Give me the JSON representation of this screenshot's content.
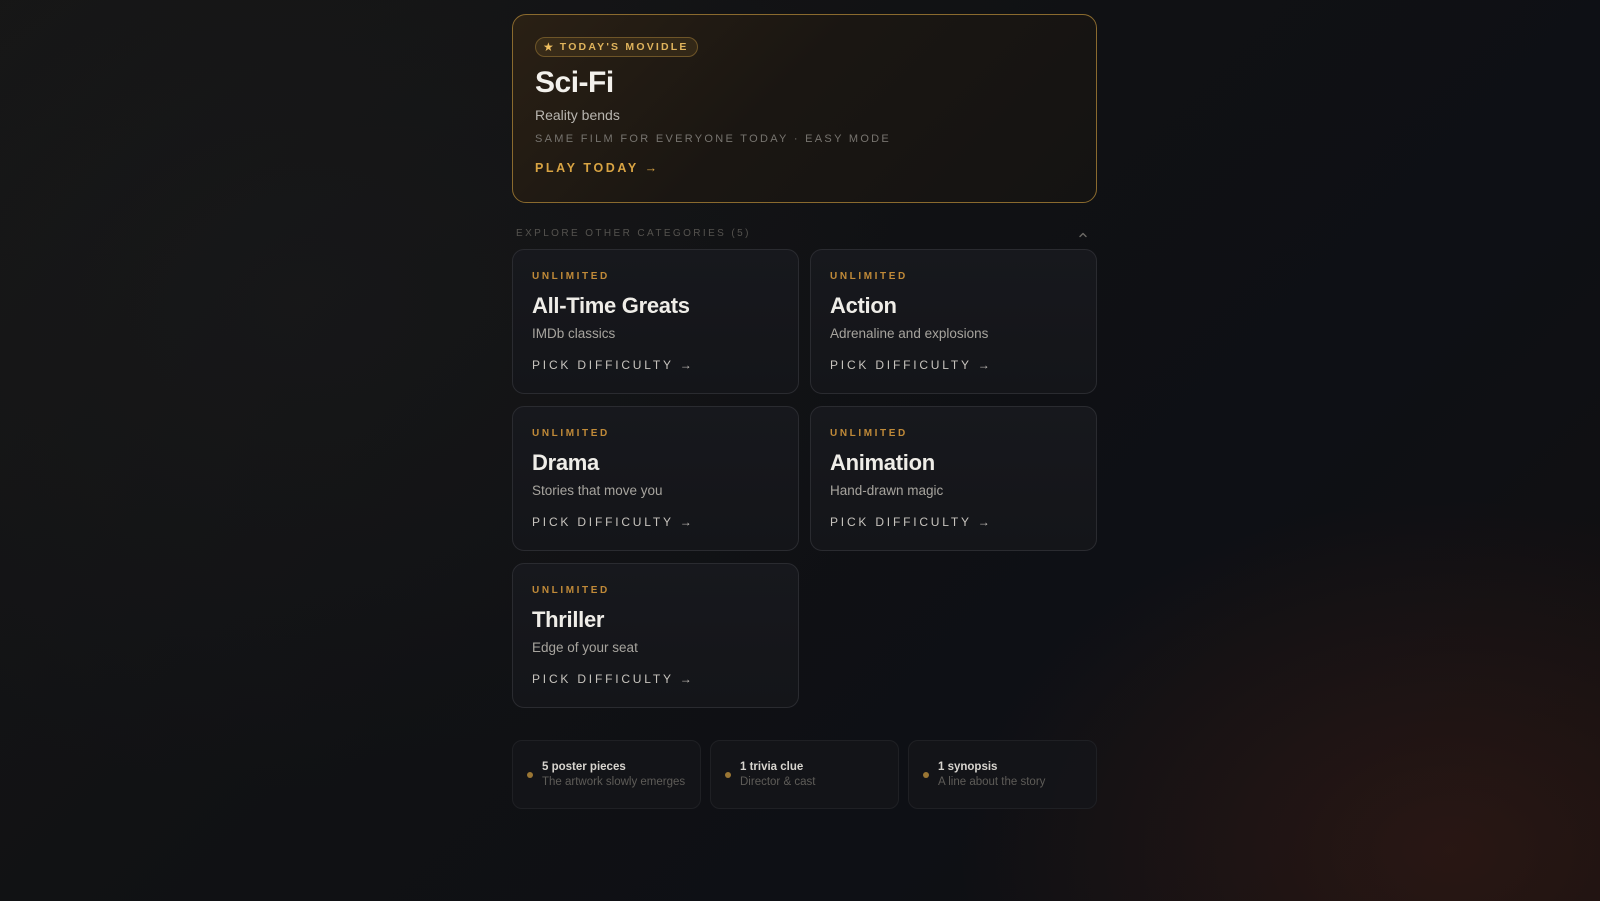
{
  "hero": {
    "badge_icon": "star-icon",
    "badge": "TODAY'S MOVIDLE",
    "title": "Sci-Fi",
    "subtitle": "Reality bends",
    "meta": "SAME FILM FOR EVERYONE TODAY · EASY MODE",
    "cta": "PLAY TODAY →",
    "accent_color": "#d9a443"
  },
  "explore": {
    "label": "EXPLORE OTHER CATEGORIES (5)",
    "toggle_icon": "chevron-up-icon"
  },
  "categories": [
    {
      "tag": "UNLIMITED",
      "title": "All-Time Greats",
      "subtitle": "IMDb classics",
      "cta": "PICK DIFFICULTY →"
    },
    {
      "tag": "UNLIMITED",
      "title": "Action",
      "subtitle": "Adrenaline and explosions",
      "cta": "PICK DIFFICULTY →"
    },
    {
      "tag": "UNLIMITED",
      "title": "Drama",
      "subtitle": "Stories that move you",
      "cta": "PICK DIFFICULTY →"
    },
    {
      "tag": "UNLIMITED",
      "title": "Animation",
      "subtitle": "Hand-drawn magic",
      "cta": "PICK DIFFICULTY →"
    },
    {
      "tag": "UNLIMITED",
      "title": "Thriller",
      "subtitle": "Edge of your seat",
      "cta": "PICK DIFFICULTY →"
    }
  ],
  "features": [
    {
      "title": "5 poster pieces",
      "subtitle": "The artwork slowly emerges"
    },
    {
      "title": "1 trivia clue",
      "subtitle": "Director & cast"
    },
    {
      "title": "1 synopsis",
      "subtitle": "A line about the story"
    }
  ]
}
